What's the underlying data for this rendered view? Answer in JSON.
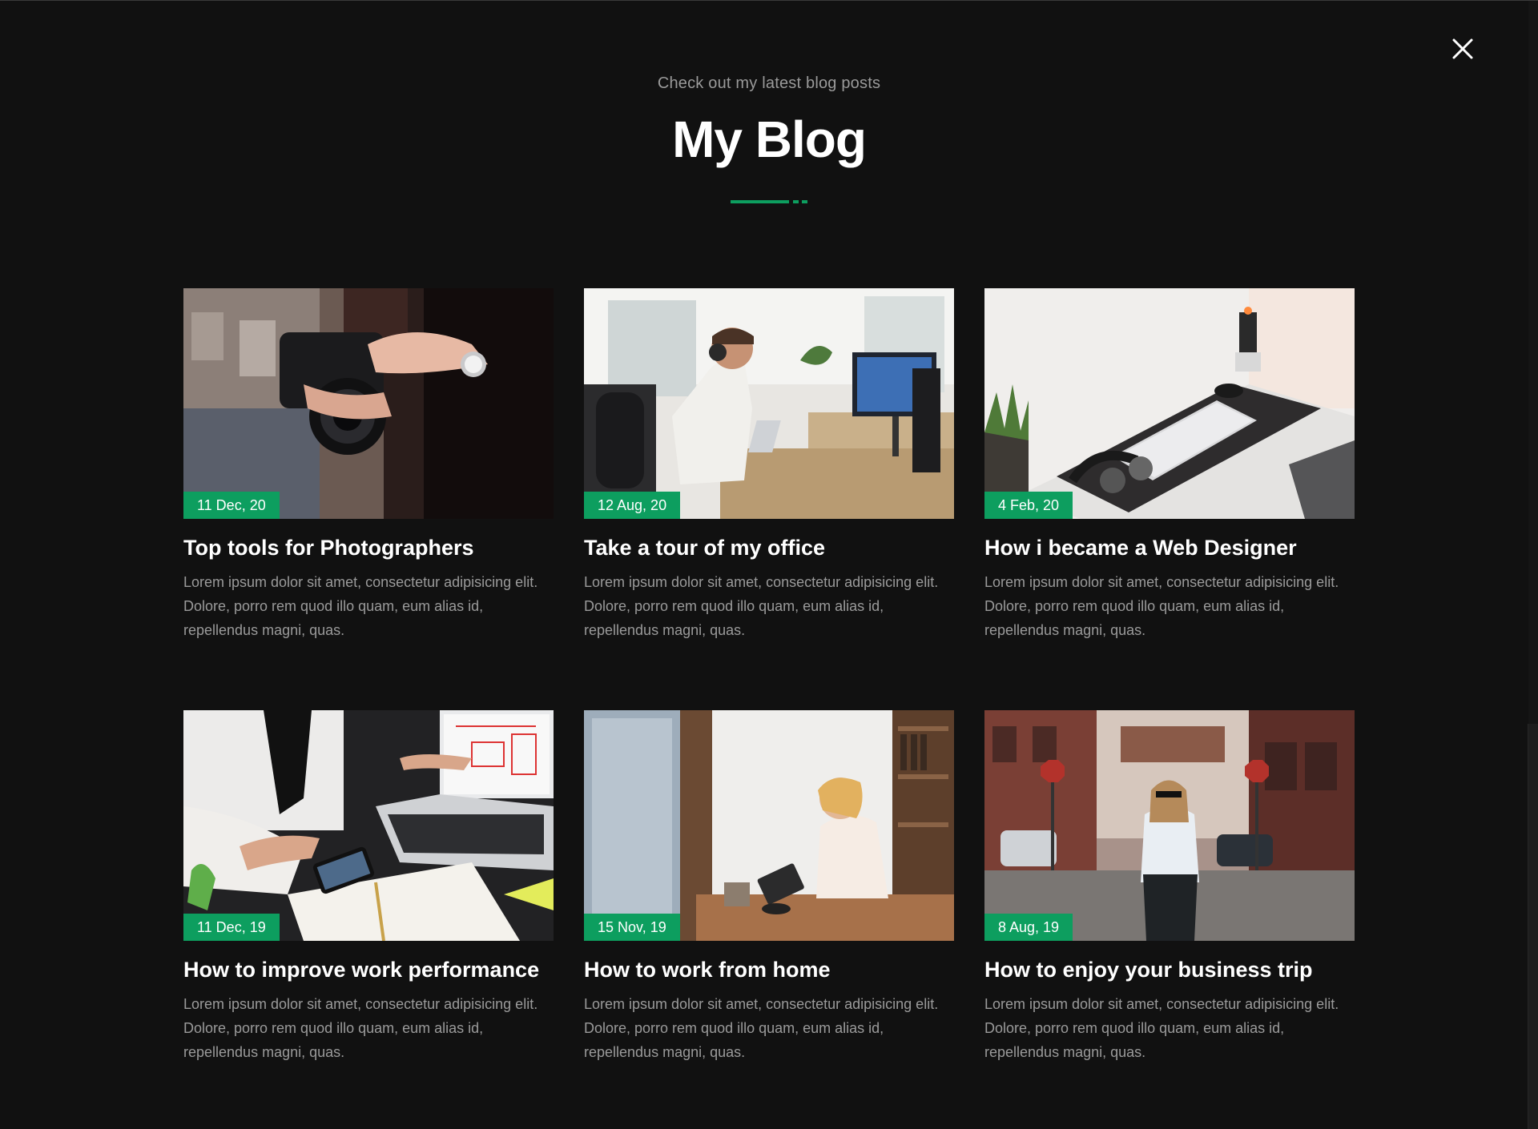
{
  "header": {
    "subtitle": "Check out my latest blog posts",
    "title": "My Blog"
  },
  "colors": {
    "accent": "#0d9e5f",
    "background": "#111111",
    "text_primary": "#ffffff",
    "text_muted": "#9a9a9a"
  },
  "icons": {
    "close": "close-icon"
  },
  "posts": [
    {
      "date": "11 Dec, 20",
      "title": "Top tools for Photographers",
      "excerpt": "Lorem ipsum dolor sit amet, consectetur adipisicing elit. Dolore, porro rem quod illo quam, eum alias id, repellendus magni, quas."
    },
    {
      "date": "12 Aug, 20",
      "title": "Take a tour of my office",
      "excerpt": "Lorem ipsum dolor sit amet, consectetur adipisicing elit. Dolore, porro rem quod illo quam, eum alias id, repellendus magni, quas."
    },
    {
      "date": "4 Feb, 20",
      "title": "How i became a Web Designer",
      "excerpt": "Lorem ipsum dolor sit amet, consectetur adipisicing elit. Dolore, porro rem quod illo quam, eum alias id, repellendus magni, quas."
    },
    {
      "date": "11 Dec, 19",
      "title": "How to improve work performance",
      "excerpt": "Lorem ipsum dolor sit amet, consectetur adipisicing elit. Dolore, porro rem quod illo quam, eum alias id, repellendus magni, quas."
    },
    {
      "date": "15 Nov, 19",
      "title": "How to work from home",
      "excerpt": "Lorem ipsum dolor sit amet, consectetur adipisicing elit. Dolore, porro rem quod illo quam, eum alias id, repellendus magni, quas."
    },
    {
      "date": "8 Aug, 19",
      "title": "How to enjoy your business trip",
      "excerpt": "Lorem ipsum dolor sit amet, consectetur adipisicing elit. Dolore, porro rem quod illo quam, eum alias id, repellendus magni, quas."
    }
  ]
}
